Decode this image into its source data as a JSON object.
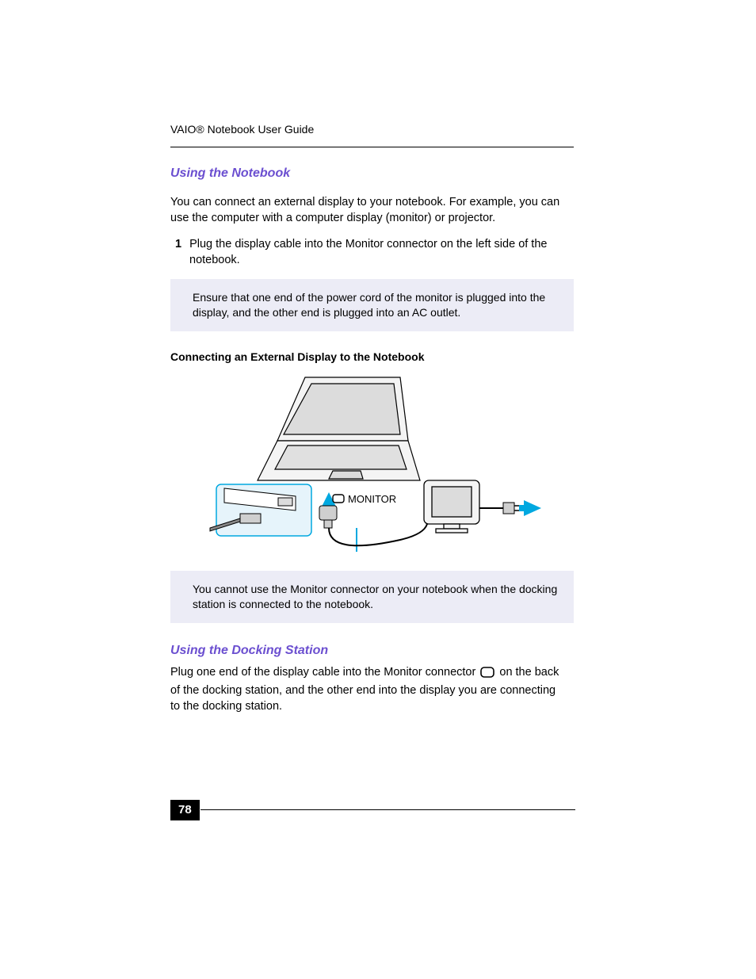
{
  "running_head": "VAIO® Notebook User Guide",
  "page_number": "78",
  "section1": {
    "heading": "Using the Notebook",
    "intro": "You can connect an external display to your notebook. For example, you can use the computer with a computer display (monitor) or projector.",
    "step1_num": "1",
    "step1_text": "Plug the display cable into the Monitor connector on the left side of the notebook.",
    "note1": "Ensure that one end of the power cord of the monitor is plugged into the display, and the other end is plugged into an AC outlet.",
    "figure_title": "Connecting an External Display to the Notebook",
    "monitor_label": "MONITOR",
    "note2": "You cannot use the Monitor connector on your notebook when the docking station is connected to the notebook."
  },
  "section2": {
    "heading": "Using the Docking Station",
    "para_before_icon": "Plug one end of the display cable into the Monitor connector ",
    "para_after_icon": " on the back of the docking station, and the other end into the display you are connecting to the docking station."
  }
}
